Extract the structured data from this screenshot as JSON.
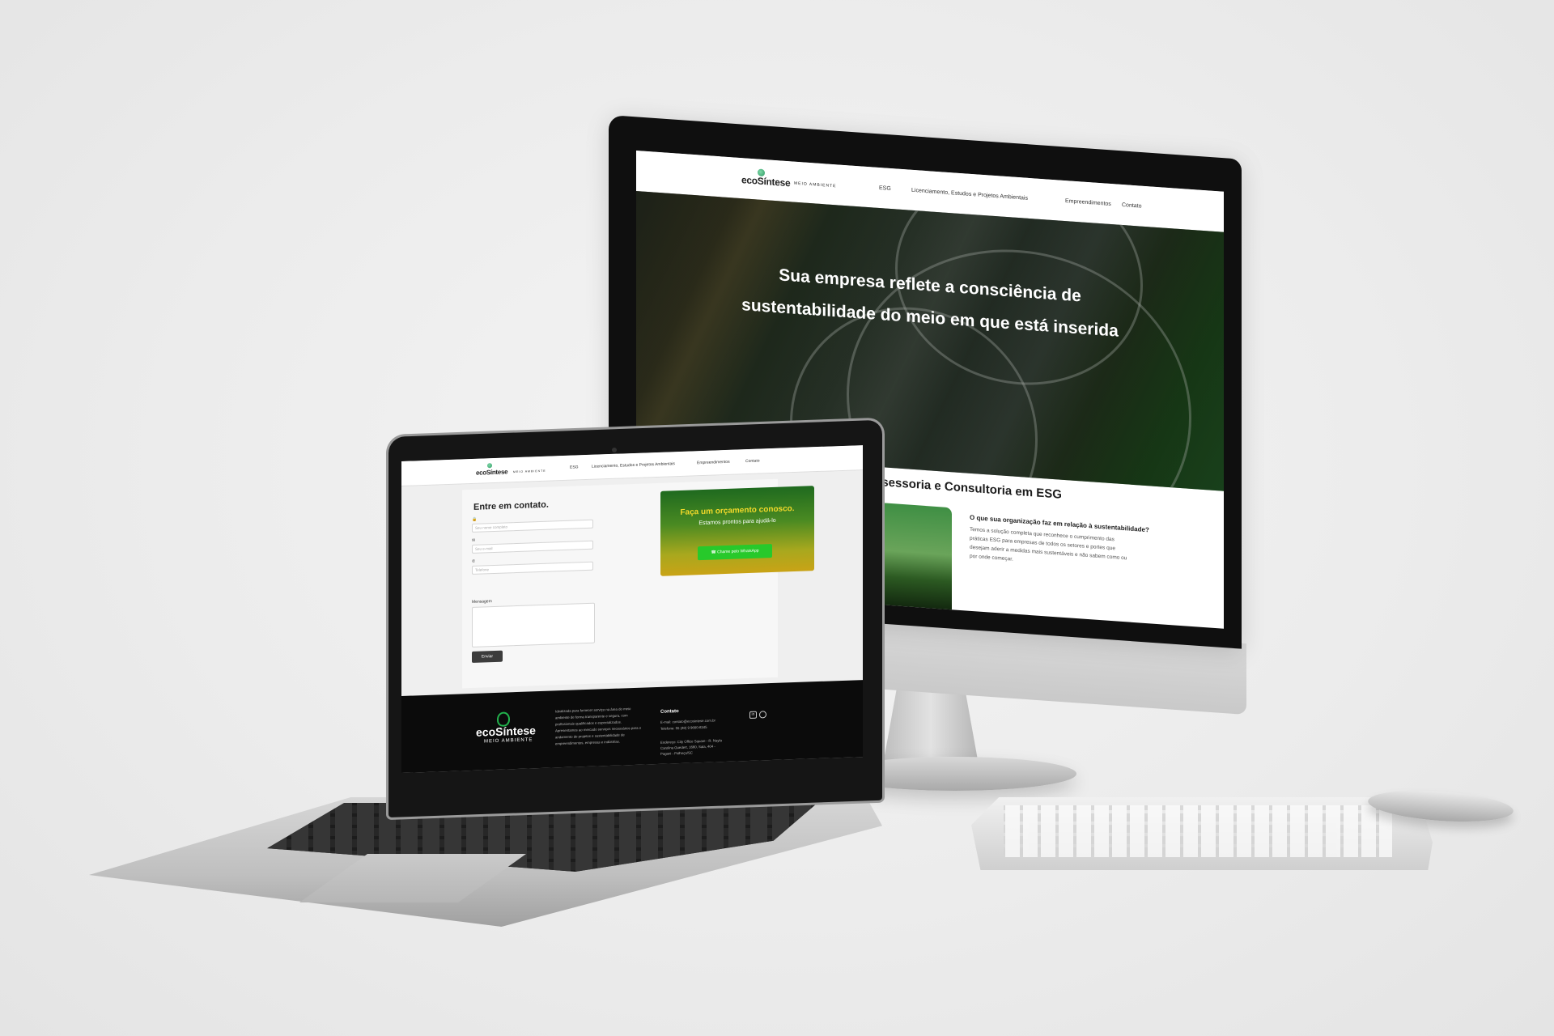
{
  "site": {
    "logo_text": "ecoSíntese",
    "logo_sub": "MEIO AMBIENTE",
    "nav": [
      "ESG",
      "Licenciamento, Estudos e Projetos Ambientais",
      "Empreendimentos",
      "Contato"
    ]
  },
  "desktop": {
    "hero_title_line1": "Sua empresa reflete a consciência de",
    "hero_title_line2": "sustentabilidade do meio em que está inserida",
    "section_title": "ssessoria e Consultoria em ESG",
    "section_image_text": "e",
    "question_title": "O que sua organização faz em relação à sustentabilidade?",
    "question_body": "Temos a solução completa que reconhece o cumprimento das práticas ESG para empresas de todos os setores e portes que desejam aderir a medidas mais sustentáveis e não sabem como ou por onde começar."
  },
  "laptop": {
    "form_title": "Entre em contato.",
    "name_placeholder": "Seu nome completo",
    "email_placeholder": "Seu e-mail",
    "phone_placeholder": "Telefone",
    "message_label": "Mensagem",
    "send_label": "Enviar",
    "cta_title": "Faça um orçamento conosco.",
    "cta_subtitle": "Estamos prontos para ajudá-lo",
    "whatsapp_label": "Chame pelo WhatsApp",
    "footer": {
      "logo_text": "ecoSíntese",
      "logo_sub": "MEIO AMBIENTE",
      "about": "Idealizada para fornecer serviço na área do meio ambiente de forma transparente e segura, com profissionais qualificados e especializados. Apresentamos ao mercado serviços necessários para o andamento de projetos e sustentabilidade de empreendimentos, empresas e indústrias.",
      "contact_heading": "Contato",
      "email": "E-mail: contato@ecosintese.com.br",
      "phone": "Telefone: 55 (48) 9 9660-8345",
      "address": "Endereço: City Office Square - R. Nayla Carolina Guedert, 1680, Sala, 404 - Pagani - Palhoça/SC"
    }
  },
  "colors": {
    "accent_green": "#22b14c",
    "cta_yellow": "#f2d92a",
    "whatsapp_green": "#27c92b"
  }
}
